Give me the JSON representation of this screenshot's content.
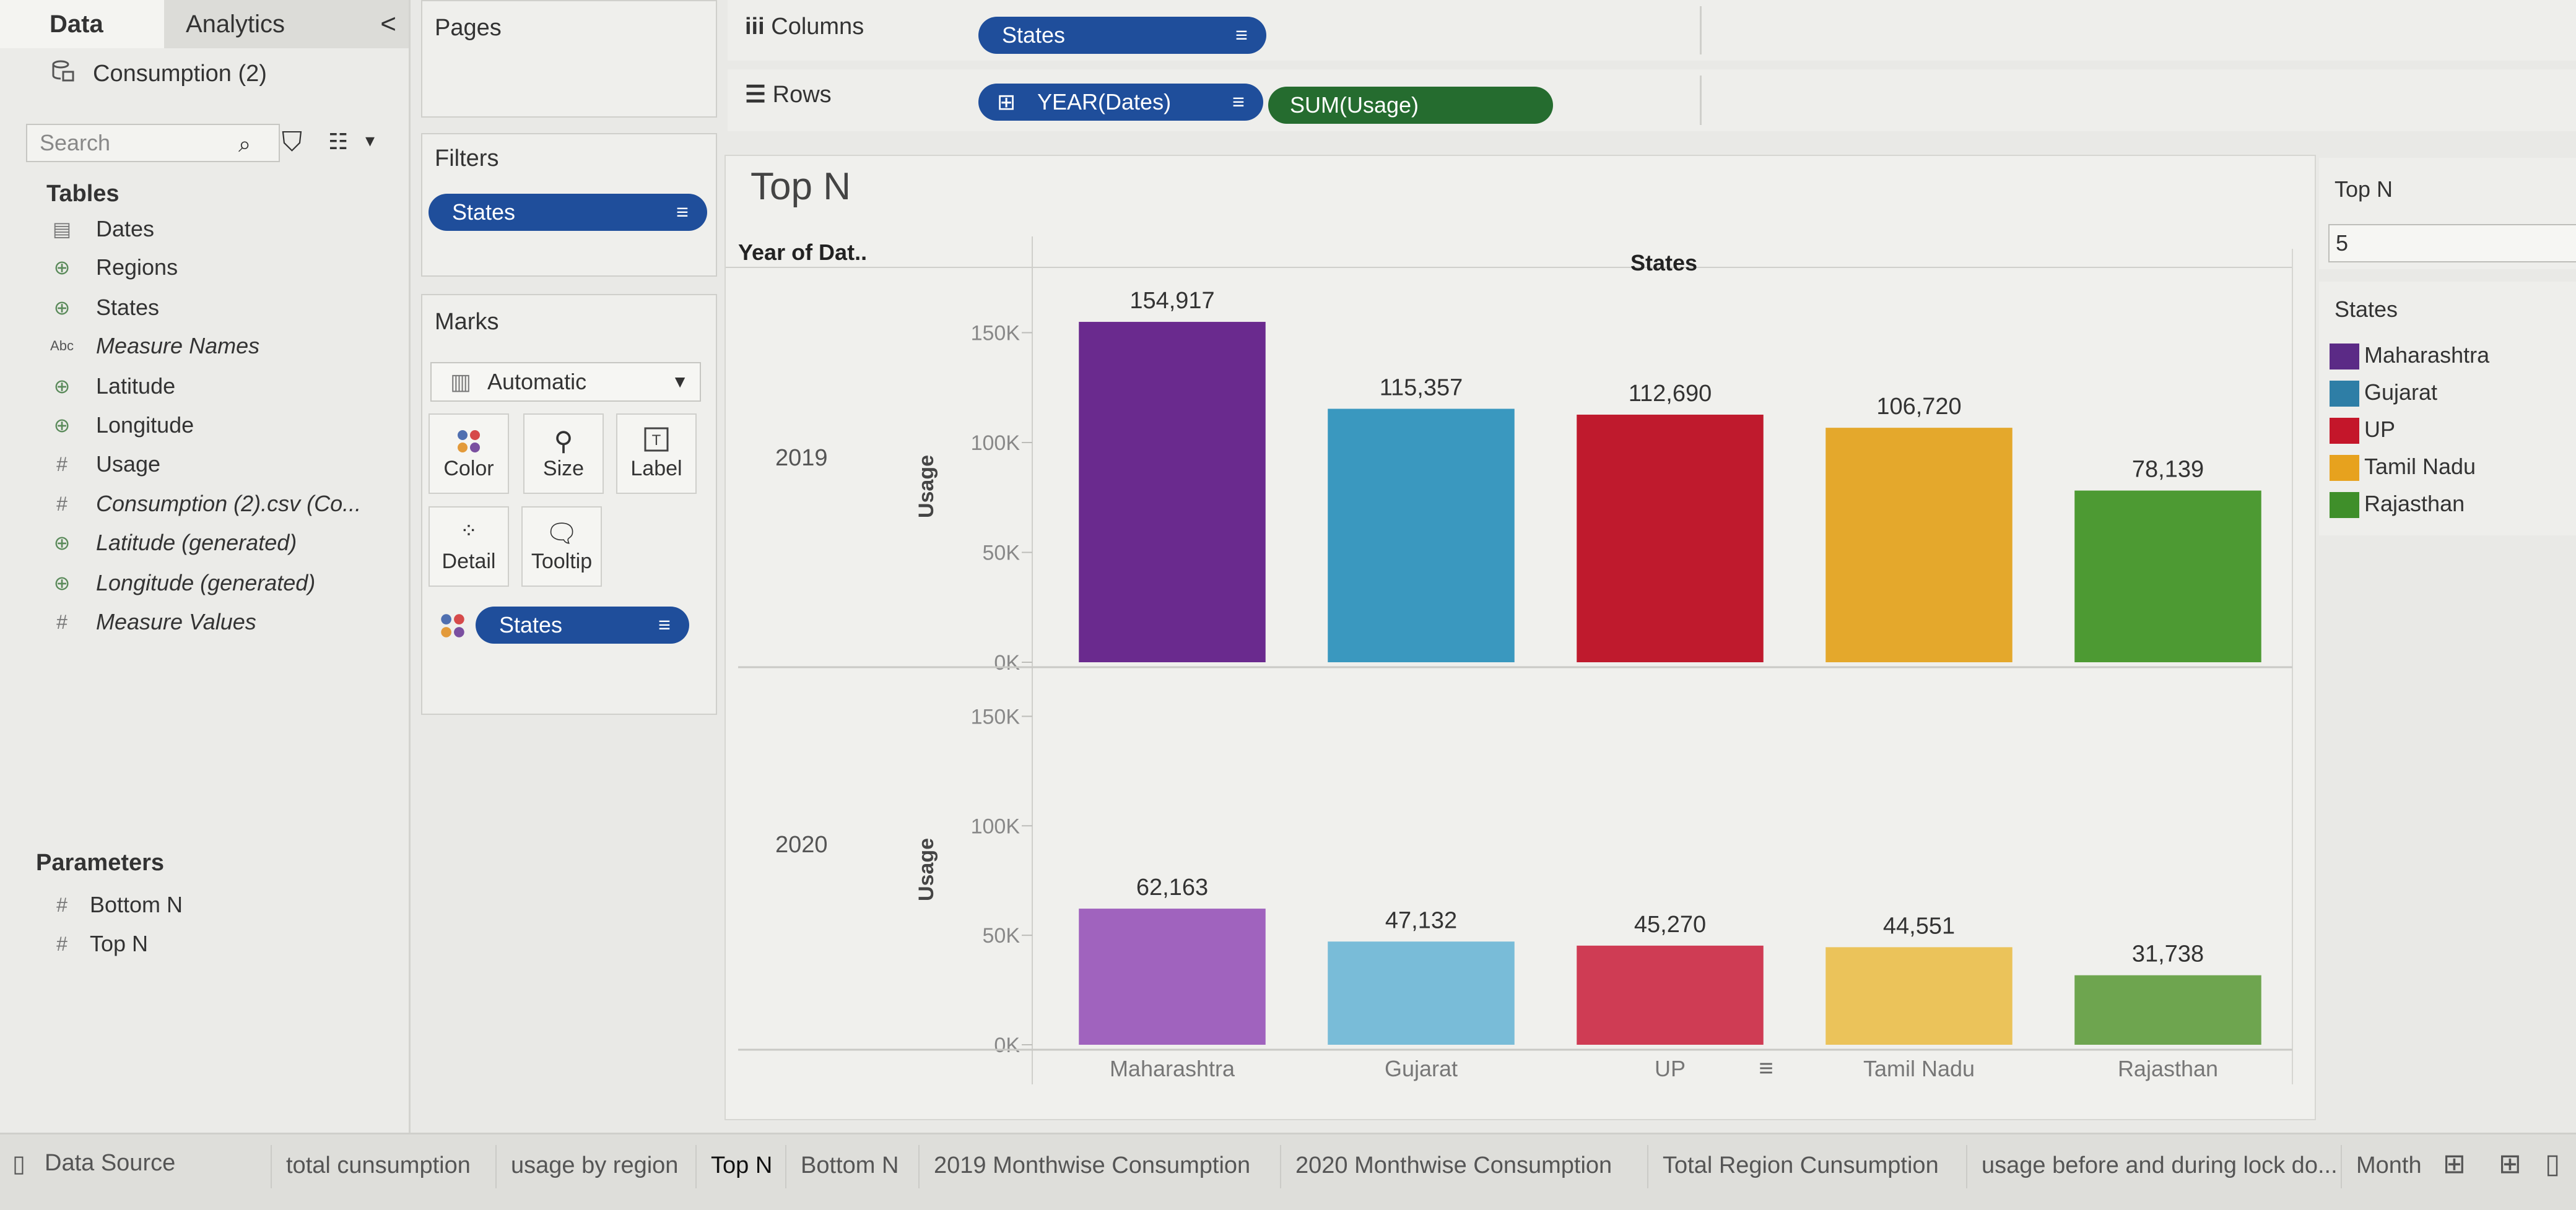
{
  "left_pane": {
    "tabs": [
      "Data",
      "Analytics"
    ],
    "collapse_glyph": "<",
    "datasource": "Consumption (2)",
    "search_placeholder": "Search",
    "tables_title": "Tables",
    "fields": [
      {
        "icon": "calendar-icon",
        "glyph": "▤",
        "label": "Dates",
        "italic": false
      },
      {
        "icon": "globe-icon",
        "glyph": "⊕",
        "label": "Regions",
        "italic": false
      },
      {
        "icon": "globe-icon",
        "glyph": "⊕",
        "label": "States",
        "italic": false
      },
      {
        "icon": "abc-icon",
        "glyph": "Abc",
        "label": "Measure Names",
        "italic": true
      },
      {
        "icon": "globe-icon",
        "glyph": "⊕",
        "label": "Latitude",
        "italic": false
      },
      {
        "icon": "globe-icon",
        "glyph": "⊕",
        "label": "Longitude",
        "italic": false
      },
      {
        "icon": "number-icon",
        "glyph": "#",
        "label": "Usage",
        "italic": false
      },
      {
        "icon": "number-icon",
        "glyph": "#",
        "label": "Consumption (2).csv (Co...",
        "italic": true
      },
      {
        "icon": "globe-icon",
        "glyph": "⊕",
        "label": "Latitude (generated)",
        "italic": true
      },
      {
        "icon": "globe-icon",
        "glyph": "⊕",
        "label": "Longitude (generated)",
        "italic": true
      },
      {
        "icon": "number-icon",
        "glyph": "#",
        "label": "Measure Values",
        "italic": true
      }
    ],
    "parameters_title": "Parameters",
    "parameters": [
      {
        "glyph": "#",
        "label": "Bottom N"
      },
      {
        "glyph": "#",
        "label": "Top N"
      }
    ]
  },
  "pages": {
    "title": "Pages"
  },
  "filters": {
    "title": "Filters",
    "pill": "States"
  },
  "marks": {
    "title": "Marks",
    "type": "Automatic",
    "buttons": [
      "Color",
      "Size",
      "Label",
      "Detail",
      "Tooltip"
    ],
    "pill": "States"
  },
  "columns": {
    "label": "Columns",
    "pill": "States"
  },
  "rows": {
    "label": "Rows",
    "pills": [
      "YEAR(Dates)",
      "SUM(Usage)"
    ]
  },
  "view": {
    "title": "Top N",
    "row_header": "Year of Dat..",
    "column_header": "States"
  },
  "parameter_card": {
    "title": "Top N",
    "value": "5"
  },
  "legend": {
    "title": "States",
    "items": [
      {
        "label": "Maharashtra",
        "color": "#5b2a86"
      },
      {
        "label": "Gujarat",
        "color": "#2e7ea6"
      },
      {
        "label": "UP",
        "color": "#c4162a"
      },
      {
        "label": "Tamil Nadu",
        "color": "#e7a21e"
      },
      {
        "label": "Rajasthan",
        "color": "#3f8f2a"
      }
    ]
  },
  "chart_data": {
    "type": "bar",
    "categories": [
      "Maharashtra",
      "Gujarat",
      "UP",
      "Tamil Nadu",
      "Rajasthan"
    ],
    "colors_2019": [
      "#6a2a8e",
      "#3a98bf",
      "#bf1a2d",
      "#e4a82c",
      "#4d9a33"
    ],
    "colors_2020": [
      "#a063be",
      "#79bcd8",
      "#cf3c54",
      "#ebc35a",
      "#6ea54f"
    ],
    "series": [
      {
        "name": "2019",
        "values": [
          154917,
          115357,
          112690,
          106720,
          78139
        ],
        "labels": [
          "154,917",
          "115,357",
          "112,690",
          "106,720",
          "78,139"
        ]
      },
      {
        "name": "2020",
        "values": [
          62163,
          47132,
          45270,
          44551,
          31738
        ],
        "labels": [
          "62,163",
          "47,132",
          "45,270",
          "44,551",
          "31,738"
        ]
      }
    ],
    "ylabel": "Usage",
    "yticks": [
      0,
      50000,
      100000,
      150000
    ],
    "ytick_labels": [
      "0K",
      "50K",
      "100K",
      "150K"
    ],
    "ylim": [
      0,
      160000
    ]
  },
  "sheet_tabs": [
    {
      "label": "Data Source",
      "active": false
    },
    {
      "label": "total cunsumption",
      "active": false
    },
    {
      "label": "usage by region",
      "active": false
    },
    {
      "label": "Top N",
      "active": true
    },
    {
      "label": "Bottom N",
      "active": false
    },
    {
      "label": "2019 Monthwise Consumption",
      "active": false
    },
    {
      "label": "2020 Monthwise Consumption",
      "active": false
    },
    {
      "label": "Total Region Cunsumption",
      "active": false
    },
    {
      "label": "usage before and during lock do...",
      "active": false
    },
    {
      "label": "Month",
      "active": false
    }
  ]
}
